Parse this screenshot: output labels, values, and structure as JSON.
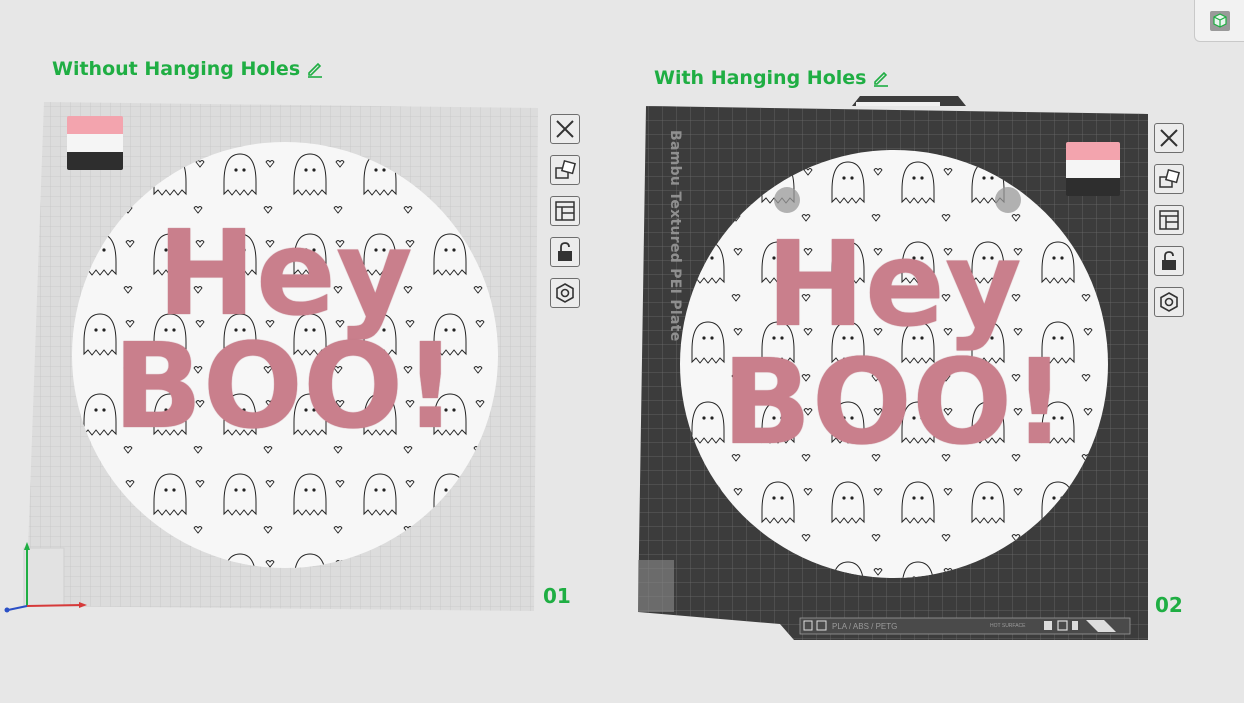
{
  "plates": [
    {
      "title": "Without Hanging Holes",
      "number": "01"
    },
    {
      "title": "With Hanging Holes",
      "number": "02"
    }
  ],
  "bed_label": "Bambu Textured PEI Plate",
  "bed_footer_label": "PLA / ABS / PETG",
  "bed_footer_small": "HOT SURFACE",
  "design_text": {
    "line1": "Hey",
    "line2": "BOO!"
  },
  "colors": {
    "accent": "#1fae43",
    "text_pink": "#c97f8c",
    "filament_pink": "#f3a4ae",
    "filament_white": "#f5f5f5",
    "filament_black": "#2e2e2e",
    "bed_dark": "#3c3c3c",
    "bed_light": "#d9d9d9"
  },
  "toolbar_icons": [
    "close-icon",
    "auto-orient-icon",
    "arrange-icon",
    "lock-icon",
    "settings-hex-icon"
  ]
}
